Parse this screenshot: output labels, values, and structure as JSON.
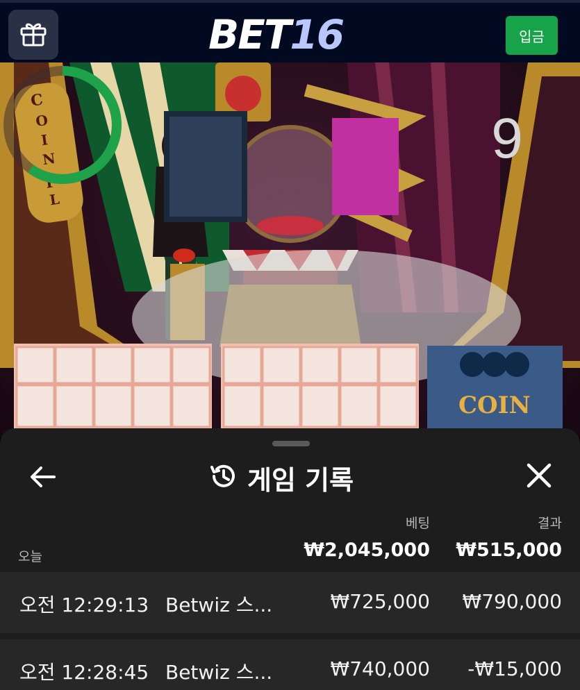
{
  "header": {
    "logo_bet": "BET",
    "logo_num": "16",
    "deposit_label": "입금",
    "gift_icon": "gift-icon"
  },
  "game": {
    "countdown": "9",
    "countdown_fraction": 0.6,
    "show_name": "Coin Flip"
  },
  "history_panel": {
    "title": "게임 기록",
    "columns": {
      "bet": "베팅",
      "result": "결과"
    },
    "today_label": "오늘",
    "totals": {
      "bet": "₩2,045,000",
      "result": "₩515,000"
    },
    "rows": [
      {
        "time": "오전 12:29:13",
        "game": "Betwiz 스...",
        "bet": "₩725,000",
        "result": "₩790,000"
      },
      {
        "time": "오전 12:28:45",
        "game": "Betwiz 스...",
        "bet": "₩740,000",
        "result": "-₩15,000"
      }
    ]
  },
  "colors": {
    "header_bg": "#020a22",
    "deposit_green": "#17a34a",
    "timer_green": "#1fa34a",
    "panel_bg": "#1d1d1d",
    "row_bg": "#272727"
  }
}
